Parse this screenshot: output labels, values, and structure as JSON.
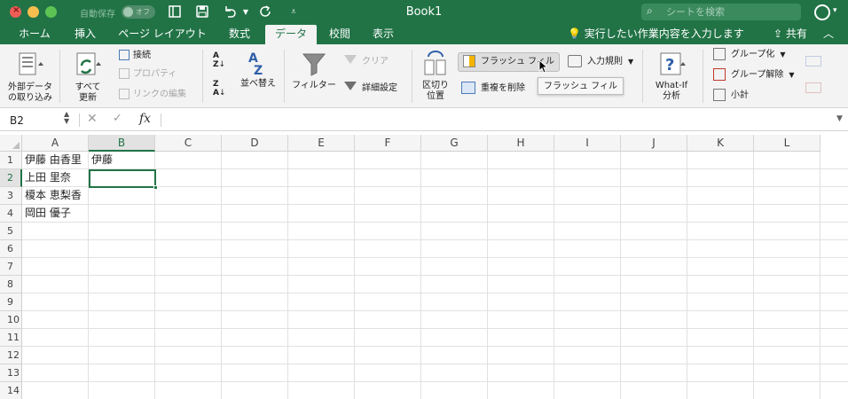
{
  "window": {
    "title": "Book1",
    "autosave_label": "自動保存",
    "autosave_state": "オフ"
  },
  "search": {
    "placeholder": "シートを検索"
  },
  "tabs": [
    {
      "label": "ホーム"
    },
    {
      "label": "挿入"
    },
    {
      "label": "ページ レイアウト"
    },
    {
      "label": "数式"
    },
    {
      "label": "データ",
      "active": true
    },
    {
      "label": "校閲"
    },
    {
      "label": "表示"
    }
  ],
  "tell_me": "実行したい作業内容を入力します",
  "share_label": "共有",
  "ribbon": {
    "external_data": "外部データ\nの取り込み",
    "external_data_l1": "外部データ",
    "external_data_l2": "の取り込み",
    "refresh_all_l1": "すべて",
    "refresh_all_l2": "更新",
    "connections": "接続",
    "properties": "プロパティ",
    "edit_links": "リンクの編集",
    "sort": "並べ替え",
    "filter": "フィルター",
    "clear": "クリア",
    "advanced": "詳細設定",
    "text_to_columns_l1": "区切り",
    "text_to_columns_l2": "位置",
    "flash_fill": "フラッシュ フィル",
    "remove_duplicates": "重複を削除",
    "data_validation": "入力規則",
    "what_if_l1": "What-If",
    "what_if_l2": "分析",
    "group": "グループ化",
    "ungroup": "グループ解除",
    "subtotal": "小計"
  },
  "tooltip": "フラッシュ フィル",
  "formula_bar": {
    "name_box": "B2",
    "fx": "fx",
    "value": ""
  },
  "columns": [
    "A",
    "B",
    "C",
    "D",
    "E",
    "F",
    "G",
    "H",
    "I",
    "J",
    "K",
    "L"
  ],
  "rows": [
    "1",
    "2",
    "3",
    "4",
    "5",
    "6",
    "7",
    "8",
    "9",
    "10",
    "11",
    "12",
    "13",
    "14"
  ],
  "cells": {
    "A1": "伊藤 由香里",
    "B1": "伊藤",
    "A2": "上田 里奈",
    "A3": "榎本 恵梨香",
    "A4": "岡田 優子"
  },
  "selected_cell": "B2"
}
